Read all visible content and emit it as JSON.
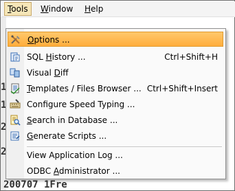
{
  "menubar": {
    "tools": {
      "prefix": "",
      "mnemonic": "T",
      "rest": "ools"
    },
    "window": {
      "prefix": "",
      "mnemonic": "W",
      "rest": "indow"
    },
    "help": {
      "prefix": "",
      "mnemonic": "H",
      "rest": "elp"
    }
  },
  "background_text": {
    "line1": "1",
    "line2": "1",
    "line3": "2",
    "line4": "2",
    "bottom": "200707 1Fre"
  },
  "tools_menu": {
    "items": [
      {
        "prefix": "",
        "mnemonic": "O",
        "rest": "ptions ...",
        "shortcut": "",
        "icon": "wrench-screwdriver-icon"
      },
      {
        "prefix": "SQL ",
        "mnemonic": "H",
        "rest": "istory ...",
        "shortcut": "Ctrl+Shift+H",
        "icon": "sql-history-icon"
      },
      {
        "prefix": "Visual ",
        "mnemonic": "D",
        "rest": "iff",
        "shortcut": "",
        "icon": "visual-diff-icon"
      },
      {
        "prefix": "",
        "mnemonic": "T",
        "rest": "emplates / Files Browser ...",
        "shortcut": "Ctrl+Shift+Insert",
        "icon": "templates-browser-icon"
      },
      {
        "prefix": "Configure Speed Typing ...",
        "mnemonic": "",
        "rest": "",
        "shortcut": "",
        "icon": "speed-typing-icon"
      },
      {
        "prefix": "",
        "mnemonic": "S",
        "rest": "earch in Database ...",
        "shortcut": "",
        "icon": "search-database-icon"
      },
      {
        "prefix": "",
        "mnemonic": "G",
        "rest": "enerate Scripts ...",
        "shortcut": "",
        "icon": "generate-scripts-icon"
      },
      {
        "prefix": "View Application Log ...",
        "mnemonic": "",
        "rest": "",
        "shortcut": "",
        "icon": ""
      },
      {
        "prefix": "ODBC ",
        "mnemonic": "A",
        "rest": "dministrator ...",
        "shortcut": "",
        "icon": ""
      }
    ]
  },
  "colors": {
    "highlight": "#ffb84d",
    "menubar_active": "#f6e6b8"
  }
}
